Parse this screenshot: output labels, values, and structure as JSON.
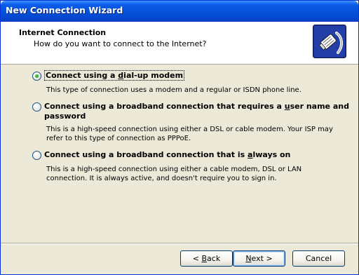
{
  "window": {
    "title": "New Connection Wizard"
  },
  "header": {
    "title": "Internet Connection",
    "subtitle": "How do you want to connect to the Internet?",
    "icon": "network-cable-icon"
  },
  "options": [
    {
      "label_pre": "Connect using a ",
      "label_key": "d",
      "label_post": "ial-up modem",
      "selected": true,
      "desc_lines": [
        "This type of connection uses a modem and a regular or ISDN phone line."
      ]
    },
    {
      "label_line1_pre": "Connect using a broadband connection that requires a ",
      "label_key": "u",
      "label_line1_post": "ser name and",
      "label_line2": "password",
      "selected": false,
      "desc_lines": [
        "This is a high-speed connection using either a DSL or cable modem. Your ISP may",
        "refer to this type of connection as PPPoE."
      ]
    },
    {
      "label_pre": "Connect using a broadband connection that is ",
      "label_key": "a",
      "label_post": "lways on",
      "selected": false,
      "desc_lines": [
        "This is a high-speed connection using either a cable modem, DSL or LAN",
        "connection. It is always active, and doesn't require you to sign in."
      ]
    }
  ],
  "buttons": {
    "back": {
      "pre": "< ",
      "key": "B",
      "post": "ack"
    },
    "next": {
      "key": "N",
      "post": "ext >"
    },
    "cancel": {
      "label": "Cancel"
    }
  }
}
